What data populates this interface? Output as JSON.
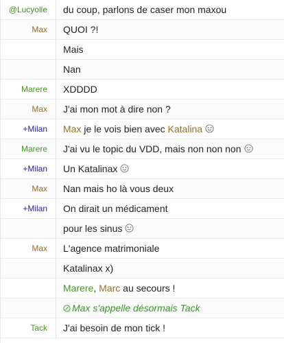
{
  "colors": {
    "lucyolle": "#3d8a26",
    "max": "#9c6c24",
    "marere": "#3f9a1e",
    "milan": "#2a20a8",
    "tack": "#3f9a1e",
    "action": "#2f9a1f",
    "text": "#222222"
  },
  "messages": [
    {
      "nick": "@Lucyolle",
      "nick_color": "#3d8a26",
      "parts": [
        {
          "text": "du coup, parlons de caser mon maxou"
        }
      ]
    },
    {
      "nick": "Max",
      "nick_color": "#9c6c24",
      "parts": [
        {
          "text": "QUOI ?!"
        }
      ]
    },
    {
      "nick": "",
      "nick_color": "#9c6c24",
      "parts": [
        {
          "text": "Mais"
        }
      ]
    },
    {
      "nick": "",
      "nick_color": "#9c6c24",
      "parts": [
        {
          "text": "Nan"
        }
      ]
    },
    {
      "nick": "Marere",
      "nick_color": "#3f9a1e",
      "parts": [
        {
          "text": "XDDDD"
        }
      ]
    },
    {
      "nick": "Max",
      "nick_color": "#9c6c24",
      "parts": [
        {
          "text": "J'ai mon mot à dire non ?"
        }
      ]
    },
    {
      "nick": "+Milan",
      "nick_color": "#2a20a8",
      "parts": [
        {
          "text": "Max",
          "color": "#9c6c24"
        },
        {
          "text": " je le vois bien avec "
        },
        {
          "text": "Katalina",
          "color": "#9c6c24"
        },
        {
          "emoji": "smiley-icon"
        }
      ]
    },
    {
      "nick": "Marere",
      "nick_color": "#3f9a1e",
      "parts": [
        {
          "text": "J'ai vu le topic du VDD, mais non non non"
        },
        {
          "emoji": "smiley-icon"
        }
      ]
    },
    {
      "nick": "+Milan",
      "nick_color": "#2a20a8",
      "parts": [
        {
          "text": "Un Katalinax"
        },
        {
          "emoji": "smiley-icon"
        }
      ]
    },
    {
      "nick": "Max",
      "nick_color": "#9c6c24",
      "parts": [
        {
          "text": "Nan mais ho là vous deux"
        }
      ]
    },
    {
      "nick": "+Milan",
      "nick_color": "#2a20a8",
      "parts": [
        {
          "text": "On dirait un médicament"
        }
      ]
    },
    {
      "nick": "",
      "nick_color": "#2a20a8",
      "parts": [
        {
          "text": "pour les sinus"
        },
        {
          "emoji": "smiley-icon"
        }
      ]
    },
    {
      "nick": "Max",
      "nick_color": "#9c6c24",
      "parts": [
        {
          "text": "L'agence matrimoniale"
        }
      ]
    },
    {
      "nick": "",
      "nick_color": "#9c6c24",
      "parts": [
        {
          "text": "Katalinax x)"
        }
      ]
    },
    {
      "nick": "",
      "nick_color": "#9c6c24",
      "parts": [
        {
          "text": "Marere",
          "color": "#3f9a1e"
        },
        {
          "text": ", "
        },
        {
          "text": "Marc",
          "color": "#9c6c24"
        },
        {
          "text": " au secours !"
        }
      ]
    },
    {
      "nick": "",
      "nick_color": "#9c6c24",
      "action": true,
      "parts": [
        {
          "icon": "action-icon"
        },
        {
          "text": "Max s'appelle désormais Tack"
        }
      ]
    },
    {
      "nick": "Tack",
      "nick_color": "#3f9a1e",
      "parts": [
        {
          "text": "J'ai besoin de mon tick !"
        }
      ]
    }
  ]
}
